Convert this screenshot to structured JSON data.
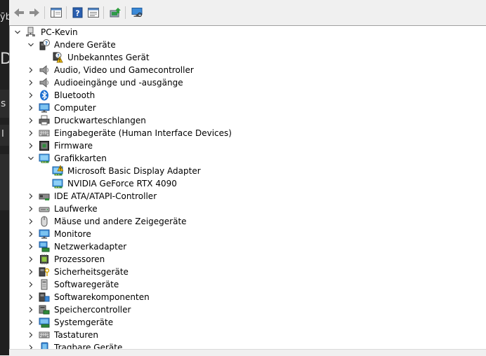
{
  "background_window": {
    "fragments": [
      "ȳb",
      "D",
      "s",
      "I"
    ]
  },
  "toolbar": {
    "buttons": [
      {
        "name": "back-button",
        "icon": "arrow-left-icon"
      },
      {
        "name": "forward-button",
        "icon": "arrow-right-icon"
      },
      {
        "name": "show-hide-console-tree-button",
        "icon": "console-tree-icon"
      },
      {
        "name": "help-button",
        "icon": "help-icon"
      },
      {
        "name": "properties-button",
        "icon": "properties-icon"
      },
      {
        "name": "update-driver-button",
        "icon": "update-driver-icon"
      },
      {
        "name": "scan-hardware-button",
        "icon": "scan-hardware-icon"
      }
    ]
  },
  "tree": {
    "rows": [
      {
        "level": 0,
        "expanded": true,
        "icon": "computer-tree-icon",
        "label": "PC-Kevin"
      },
      {
        "level": 1,
        "expanded": true,
        "icon": "unknown-device-icon",
        "label": "Andere Geräte"
      },
      {
        "level": 2,
        "expanded": null,
        "icon": "warning-device-icon",
        "label": "Unbekanntes Gerät"
      },
      {
        "level": 1,
        "expanded": false,
        "icon": "speaker-icon",
        "label": "Audio, Video und Gamecontroller"
      },
      {
        "level": 1,
        "expanded": false,
        "icon": "speaker-icon",
        "label": "Audioeingänge und -ausgänge"
      },
      {
        "level": 1,
        "expanded": false,
        "icon": "bluetooth-icon",
        "label": "Bluetooth"
      },
      {
        "level": 1,
        "expanded": false,
        "icon": "monitor-icon",
        "label": "Computer"
      },
      {
        "level": 1,
        "expanded": false,
        "icon": "printer-icon",
        "label": "Druckwarteschlangen"
      },
      {
        "level": 1,
        "expanded": false,
        "icon": "keyboard-icon",
        "label": "Eingabegeräte (Human Interface Devices)"
      },
      {
        "level": 1,
        "expanded": false,
        "icon": "firmware-icon",
        "label": "Firmware"
      },
      {
        "level": 1,
        "expanded": true,
        "icon": "display-adapter-icon",
        "label": "Grafikkarten"
      },
      {
        "level": 2,
        "expanded": null,
        "icon": "warning-display-icon",
        "label": "Microsoft Basic Display Adapter"
      },
      {
        "level": 2,
        "expanded": null,
        "icon": "display-adapter-icon",
        "label": "NVIDIA GeForce RTX 4090"
      },
      {
        "level": 1,
        "expanded": false,
        "icon": "ide-controller-icon",
        "label": "IDE ATA/ATAPI-Controller"
      },
      {
        "level": 1,
        "expanded": false,
        "icon": "drive-icon",
        "label": "Laufwerke"
      },
      {
        "level": 1,
        "expanded": false,
        "icon": "mouse-icon",
        "label": "Mäuse und andere Zeigegeräte"
      },
      {
        "level": 1,
        "expanded": false,
        "icon": "monitor-icon",
        "label": "Monitore"
      },
      {
        "level": 1,
        "expanded": false,
        "icon": "network-adapter-icon",
        "label": "Netzwerkadapter"
      },
      {
        "level": 1,
        "expanded": false,
        "icon": "processor-icon",
        "label": "Prozessoren"
      },
      {
        "level": 1,
        "expanded": false,
        "icon": "security-device-icon",
        "label": "Sicherheitsgeräte"
      },
      {
        "level": 1,
        "expanded": false,
        "icon": "software-device-icon",
        "label": "Softwaregeräte"
      },
      {
        "level": 1,
        "expanded": false,
        "icon": "software-component-icon",
        "label": "Softwarekomponenten"
      },
      {
        "level": 1,
        "expanded": false,
        "icon": "storage-controller-icon",
        "label": "Speichercontroller"
      },
      {
        "level": 1,
        "expanded": false,
        "icon": "system-device-icon",
        "label": "Systemgeräte"
      },
      {
        "level": 1,
        "expanded": false,
        "icon": "keyboard-icon",
        "label": "Tastaturen"
      },
      {
        "level": 1,
        "expanded": false,
        "icon": "portable-device-icon",
        "label": "Tragbare Geräte"
      }
    ]
  },
  "colors": {
    "accent_blue": "#1c6fd0",
    "warning_yellow": "#f4c20d",
    "tree_background": "#ffffff",
    "toolbar_background": "#f0f0f0"
  }
}
